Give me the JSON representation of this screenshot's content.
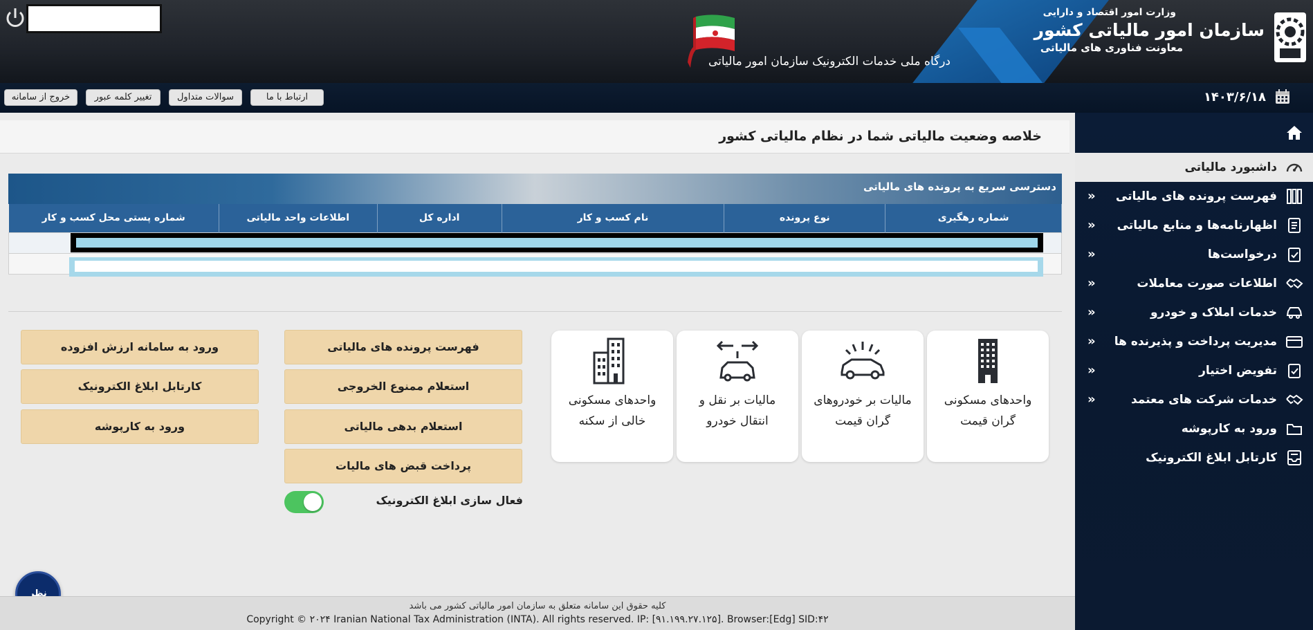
{
  "header": {
    "ministry": "وزارت امور اقتصاد و دارایی",
    "organization": "سازمان امور مالیاتی کشور",
    "deputy": "معاونت فناوری های مالیاتی",
    "portal_title": "درگاه ملی خدمات الکترونیک سازمان امور مالیاتی"
  },
  "topbar": {
    "date": "۱۴۰۳/۶/۱۸",
    "contact": "ارتباط با ما",
    "faq": "سوالات متداول",
    "change_password": "تغییر کلمه عبور",
    "logout": "خروج از سامانه"
  },
  "sidebar": {
    "items": [
      {
        "label": "داشبورد مالیاتی",
        "icon": "gauge-icon",
        "active": true
      },
      {
        "label": "فهرست پرونده های مالیاتی",
        "icon": "binders-icon"
      },
      {
        "label": "اظهارنامه‌ها و منابع مالیاتی",
        "icon": "document-icon"
      },
      {
        "label": "درخواست‌ها",
        "icon": "clipboard-check-icon"
      },
      {
        "label": "اطلاعات صورت معاملات",
        "icon": "handshake-icon"
      },
      {
        "label": "خدمات املاک و خودرو",
        "icon": "car-icon"
      },
      {
        "label": "مدیریت پرداخت و پذیرنده ها",
        "icon": "credit-card-icon"
      },
      {
        "label": "تفویض اختیار",
        "icon": "clipboard-check-icon"
      },
      {
        "label": "خدمات شرکت های معتمد",
        "icon": "handshake-icon"
      },
      {
        "label": "ورود به کارپوشه",
        "icon": "folder-icon"
      },
      {
        "label": "کارتابل ابلاغ الکترونیک",
        "icon": "inbox-icon"
      }
    ],
    "chevron": "»"
  },
  "main": {
    "page_title": "خلاصه وضعیت مالیاتی شما در نظام مالیاتی کشور",
    "quick_access_title": "دسترسی سریع به پرونده های مالیاتی",
    "table_headers": [
      "شماره رهگیری",
      "نوع پرونده",
      "نام کسب و کار",
      "اداره کل",
      "اطلاعات واحد مالیاتی",
      "شماره پستی محل کسب و کار"
    ]
  },
  "cards": [
    {
      "label": "واحدهای مسکونی گران قیمت",
      "icon": "building-icon"
    },
    {
      "label": "مالیات بر خودروهای گران قیمت",
      "icon": "luxury-car-icon"
    },
    {
      "label": "مالیات بر نقل و انتقال خودرو",
      "icon": "car-transfer-icon"
    },
    {
      "label": "واحدهای مسکونی خالی از سکنه",
      "icon": "apartment-icon"
    }
  ],
  "services": {
    "col1": [
      "فهرست پرونده های مالیاتی",
      "استعلام ممنوع الخروجی",
      "استعلام بدهی مالیاتی",
      "پرداخت قبض های مالیات"
    ],
    "col2": [
      "ورود به سامانه ارزش افزوده",
      "کارتابل ابلاغ الکترونیک",
      "ورود به کارپوشه"
    ]
  },
  "toggle": {
    "label": "فعال سازی ابلاغ الکترونیک",
    "on": true,
    "color": "#4cc45f"
  },
  "survey": {
    "label": "نظر سنجی"
  },
  "footer": {
    "rights": "کلیه حقوق این سامانه متعلق به سازمان امور مالیاتی کشور می باشد",
    "copyright": "Copyright © ۲۰۲۴ Iranian National Tax Administration (INTA). All rights reserved. IP: [۹۱.۱۹۹.۲۷.۱۲۵]. Browser:[Edg] SID:۴۲"
  },
  "colors": {
    "sidebar_bg": "#0b1c36",
    "table_header": "#2b6299",
    "service_btn": "#efd6aa"
  }
}
